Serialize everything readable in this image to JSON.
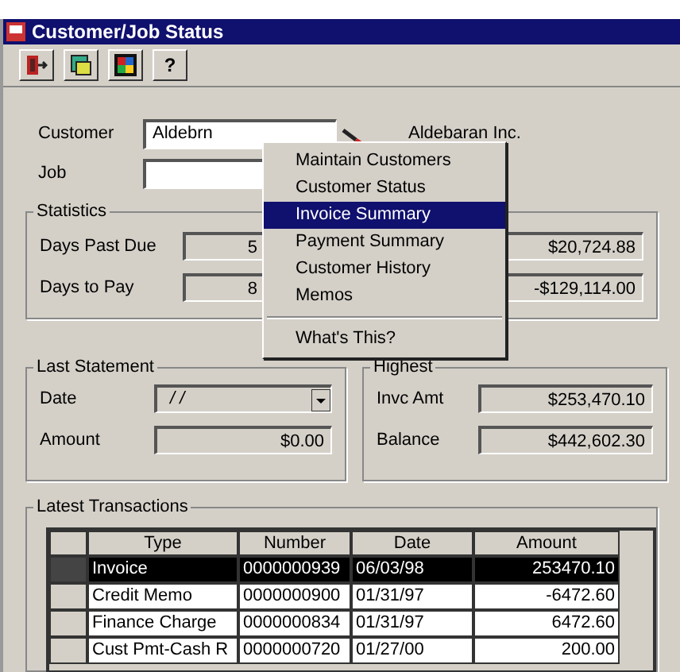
{
  "window": {
    "title": "Customer/Job Status"
  },
  "toolbar": [
    {
      "kind": "exit"
    },
    {
      "kind": "browse"
    },
    {
      "kind": "colors"
    },
    {
      "kind": "help",
      "label": "?"
    }
  ],
  "customer": {
    "label": "Customer",
    "value": "Aldebrn",
    "name": "Aldebaran Inc."
  },
  "job": {
    "label": "Job"
  },
  "statistics": {
    "title": "Statistics",
    "rows": [
      {
        "label": "Days Past Due",
        "value": "5",
        "right_value": "$20,724.88"
      },
      {
        "label": "Days to Pay",
        "value": "8",
        "right_value": "-$129,114.00"
      }
    ]
  },
  "last_statement": {
    "title": "Last Statement",
    "date_label": "Date",
    "date_value": "/ /",
    "amount_label": "Amount",
    "amount_value": "$0.00"
  },
  "highest": {
    "title": "Highest",
    "rows": [
      {
        "label": "Invc Amt",
        "value": "$253,470.10"
      },
      {
        "label": "Balance",
        "value": "$442,602.30"
      }
    ]
  },
  "transactions": {
    "title": "Latest Transactions",
    "columns": [
      "Type",
      "Number",
      "Date",
      "Amount"
    ],
    "rows": [
      {
        "cells": [
          "Invoice",
          "0000000939",
          "06/03/98",
          "253470.10"
        ],
        "selected": true
      },
      {
        "cells": [
          "Credit Memo",
          "0000000900",
          "01/31/97",
          "-6472.60"
        ],
        "selected": false
      },
      {
        "cells": [
          "Finance Charge",
          "0000000834",
          "01/31/97",
          "6472.60"
        ],
        "selected": false
      },
      {
        "cells": [
          "Cust Pmt-Cash R",
          "0000000720",
          "01/27/00",
          "200.00"
        ],
        "selected": false
      }
    ]
  },
  "context_menu": [
    {
      "kind": "item",
      "label": "Maintain Customers",
      "selected": false
    },
    {
      "kind": "item",
      "label": "Customer Status",
      "selected": false
    },
    {
      "kind": "item",
      "label": "Invoice Summary",
      "selected": true
    },
    {
      "kind": "item",
      "label": "Payment Summary",
      "selected": false
    },
    {
      "kind": "item",
      "label": "Customer History",
      "selected": false
    },
    {
      "kind": "item",
      "label": "Memos",
      "selected": false
    },
    {
      "kind": "separator"
    },
    {
      "kind": "item",
      "label": "What's This?",
      "selected": false
    }
  ]
}
